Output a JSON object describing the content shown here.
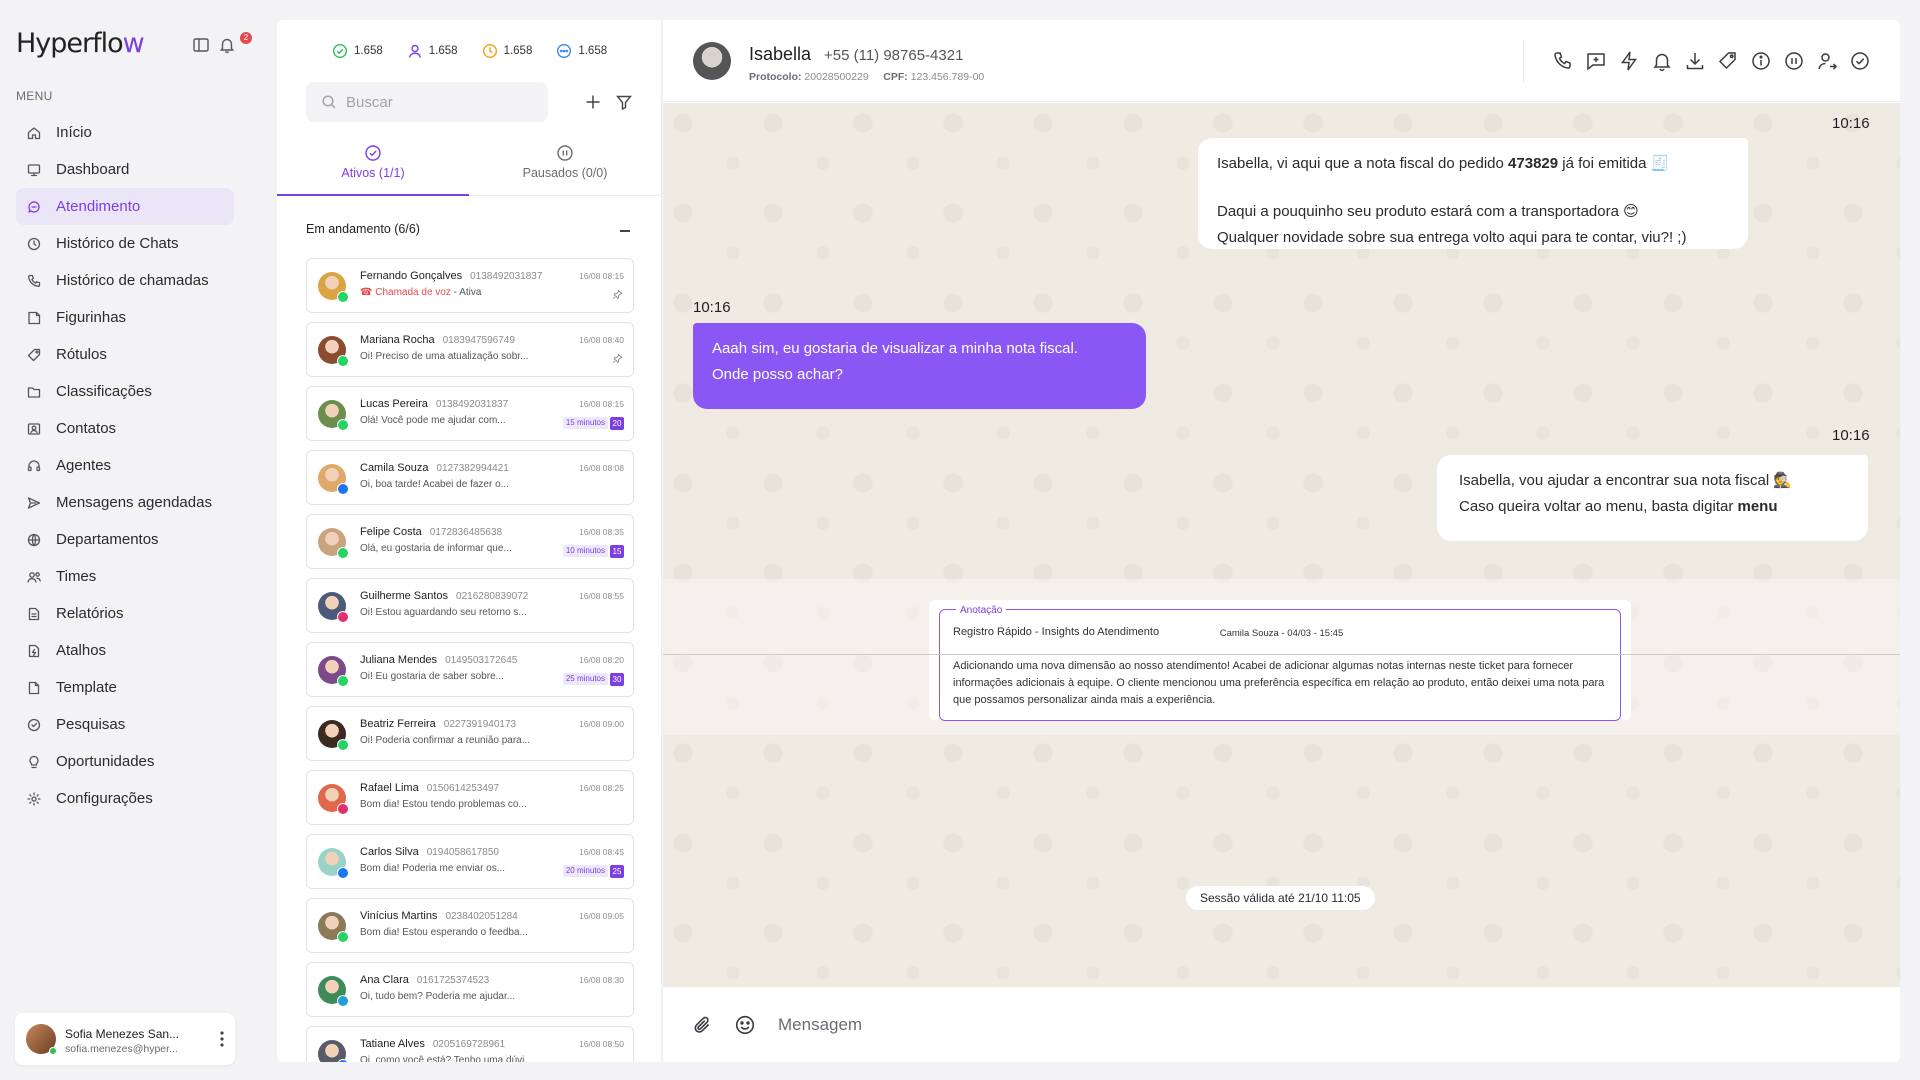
{
  "sidebar": {
    "logo": {
      "main": "Hyperflo",
      "accent": "w"
    },
    "notif_count": "2",
    "menu_label": "MENU",
    "items": [
      {
        "label": "Início",
        "icon": "home-icon"
      },
      {
        "label": "Dashboard",
        "icon": "dashboard-icon"
      },
      {
        "label": "Atendimento",
        "icon": "chat-icon",
        "active": true
      },
      {
        "label": "Histórico de Chats",
        "icon": "history-icon"
      },
      {
        "label": "Histórico de chamadas",
        "icon": "phone-history-icon"
      },
      {
        "label": "Figurinhas",
        "icon": "sticker-icon"
      },
      {
        "label": "Rótulos",
        "icon": "tag-icon"
      },
      {
        "label": "Classificações",
        "icon": "folder-icon"
      },
      {
        "label": "Contatos",
        "icon": "contacts-icon"
      },
      {
        "label": "Agentes",
        "icon": "headset-icon"
      },
      {
        "label": "Mensagens agendadas",
        "icon": "send-icon"
      },
      {
        "label": "Departamentos",
        "icon": "departments-icon"
      },
      {
        "label": "Times",
        "icon": "team-icon"
      },
      {
        "label": "Relatórios",
        "icon": "report-icon"
      },
      {
        "label": "Atalhos",
        "icon": "shortcut-icon"
      },
      {
        "label": "Template",
        "icon": "template-icon"
      },
      {
        "label": "Pesquisas",
        "icon": "survey-icon"
      },
      {
        "label": "Oportunidades",
        "icon": "opportunity-icon"
      },
      {
        "label": "Configurações",
        "icon": "settings-icon"
      }
    ],
    "user": {
      "name": "Sofia Menezes San...",
      "email": "sofia.menezes@hyper..."
    }
  },
  "list": {
    "stats": [
      {
        "value": "1.658",
        "icon": "check-circle-icon",
        "color": "#2fbf5b"
      },
      {
        "value": "1.658",
        "icon": "user-icon",
        "color": "#7b3fe4"
      },
      {
        "value": "1.658",
        "icon": "clock-icon",
        "color": "#f59e0b"
      },
      {
        "value": "1.658",
        "icon": "dots-circle-icon",
        "color": "#3b82f6"
      }
    ],
    "search_placeholder": "Buscar",
    "tabs": [
      {
        "label": "Ativos (1/1)"
      },
      {
        "label": "Pausados (0/0)"
      }
    ],
    "section_title": "Em andamento (6/6)",
    "conversations": [
      {
        "name": "Fernando Gonçalves",
        "number": "0138492031837",
        "date": "16/08 08:15",
        "voice_label": "Chamada de voz",
        "voice_state": " - Ativa",
        "preview": "",
        "channel": "whatsapp",
        "pinned": true,
        "timer": "",
        "count": "",
        "avatar": "#d9a441"
      },
      {
        "name": "Mariana Rocha",
        "number": "0183947596749",
        "date": "16/08 08:40",
        "preview": "Oi! Preciso de uma atualização sobr...",
        "channel": "whatsapp",
        "pinned": true,
        "timer": "",
        "count": "",
        "avatar": "#8a4b2f"
      },
      {
        "name": "Lucas Pereira",
        "number": "0138492031837",
        "date": "16/08 08:15",
        "preview": "Olá! Você pode me ajudar com...",
        "channel": "whatsapp",
        "pinned": false,
        "timer": "15 minutos",
        "count": "20",
        "avatar": "#6b8e4e"
      },
      {
        "name": "Camila Souza",
        "number": "0127382994421",
        "date": "16/08 08:08",
        "preview": "Oi, boa tarde! Acabei de fazer o...",
        "channel": "messenger",
        "pinned": false,
        "timer": "",
        "count": "",
        "avatar": "#e0a86a"
      },
      {
        "name": "Felipe Costa",
        "number": "0172836485638",
        "date": "16/08 08:35",
        "preview": "Olá, eu gostaria de informar que...",
        "channel": "whatsapp",
        "pinned": false,
        "timer": "10 minutos",
        "count": "15",
        "avatar": "#c9a27e"
      },
      {
        "name": "Guilherme Santos",
        "number": "0216280839072",
        "date": "16/08 08:55",
        "preview": "Oi! Estou aguardando seu retorno s...",
        "channel": "instagram",
        "pinned": false,
        "timer": "",
        "count": "",
        "avatar": "#4a5a7a"
      },
      {
        "name": "Juliana Mendes",
        "number": "0149503172645",
        "date": "16/08 08:20",
        "preview": "Oi! Eu gostaria de saber sobre...",
        "channel": "whatsapp",
        "pinned": false,
        "timer": "25 minutos",
        "count": "30",
        "avatar": "#7a4a8a"
      },
      {
        "name": "Beatriz Ferreira",
        "number": "0227391940173",
        "date": "16/08 09:00",
        "preview": "Oi! Poderia confirmar a reunião para...",
        "channel": "whatsapp",
        "pinned": false,
        "timer": "",
        "count": "",
        "avatar": "#3a2a22"
      },
      {
        "name": "Rafael Lima",
        "number": "0150614253497",
        "date": "16/08 08:25",
        "preview": "Bom dia! Estou tendo problemas co...",
        "channel": "instagram",
        "pinned": false,
        "timer": "",
        "count": "",
        "avatar": "#e0674a"
      },
      {
        "name": "Carlos Silva",
        "number": "0194058617850",
        "date": "16/08 08:45",
        "preview": "Bom dia! Poderia me enviar os...",
        "channel": "messenger",
        "pinned": false,
        "timer": "20 minutos",
        "count": "25",
        "avatar": "#9ad3c7"
      },
      {
        "name": "Vinícius Martins",
        "number": "0238402051284",
        "date": "16/08 09:05",
        "preview": "Bom dia! Estou esperando o feedba...",
        "channel": "whatsapp",
        "pinned": false,
        "timer": "",
        "count": "",
        "avatar": "#8a7a5a"
      },
      {
        "name": "Ana Clara",
        "number": "0161725374523",
        "date": "16/08 08:30",
        "preview": "Oi, tudo bem? Poderia me ajudar...",
        "channel": "telegram",
        "pinned": false,
        "timer": "",
        "count": "",
        "avatar": "#3f8a5a"
      },
      {
        "name": "Tatiane Alves",
        "number": "0205169728961",
        "date": "16/08 08:50",
        "preview": "Oi, como você está? Tenho uma dúvi...",
        "channel": "messenger",
        "pinned": false,
        "timer": "",
        "count": "",
        "avatar": "#5a5a6a"
      }
    ]
  },
  "chat": {
    "contact": {
      "name": "Isabella",
      "phone": "+55 (11) 98765-4321",
      "protocol_label": "Protocolo:",
      "protocol": "20028500229",
      "cpf_label": "CPF:",
      "cpf": "123.456.789-00"
    },
    "actions": [
      "phone-icon",
      "message-plus-icon",
      "bolt-icon",
      "bell-icon",
      "download-icon",
      "tags-icon",
      "info-icon",
      "pause-icon",
      "transfer-user-icon",
      "check-circle-icon"
    ],
    "messages": [
      {
        "dir": "out",
        "time": "10:16",
        "line1_pre": "Isabella, vi aqui que a nota fiscal do pedido ",
        "line1_bold": "473829",
        "line1_post": " já foi emitida 🧾",
        "line2": "Daqui a pouquinho seu produto estará com a transportadora 😊",
        "line3": "Qualquer novidade sobre sua entrega volto aqui para te contar, viu?! ;)"
      },
      {
        "dir": "in",
        "time": "10:16",
        "line1": "Aaah sim, eu gostaria de visualizar a minha nota fiscal.",
        "line2": "Onde posso achar?"
      },
      {
        "dir": "out",
        "time": "10:16",
        "line1": "Isabella, vou ajudar a encontrar sua nota fiscal 🕵️",
        "line2_pre": "Caso queira voltar ao menu, basta digitar ",
        "line2_bold": "menu"
      }
    ],
    "note": {
      "legend": "Anotação",
      "title": "Registro Rápido - Insights do Atendimento",
      "body": "Adicionando uma nova dimensão ao nosso atendimento! Acabei de adicionar algumas notas internas neste ticket para fornecer informações adicionais à equipe. O cliente mencionou uma preferência específica em relação ao produto, então deixei uma nota para que possamos personalizar ainda mais a experiência.",
      "signature": "Camila Souza - 04/03 - 15:45"
    },
    "session": "Sessão válida até 21/10 11:05",
    "composer_placeholder": "Mensagem"
  },
  "colors": {
    "accent": "#7b3fe4",
    "bubble_in": "#8b57f4",
    "chat_bg": "#efeae2",
    "danger": "#e5484d"
  }
}
